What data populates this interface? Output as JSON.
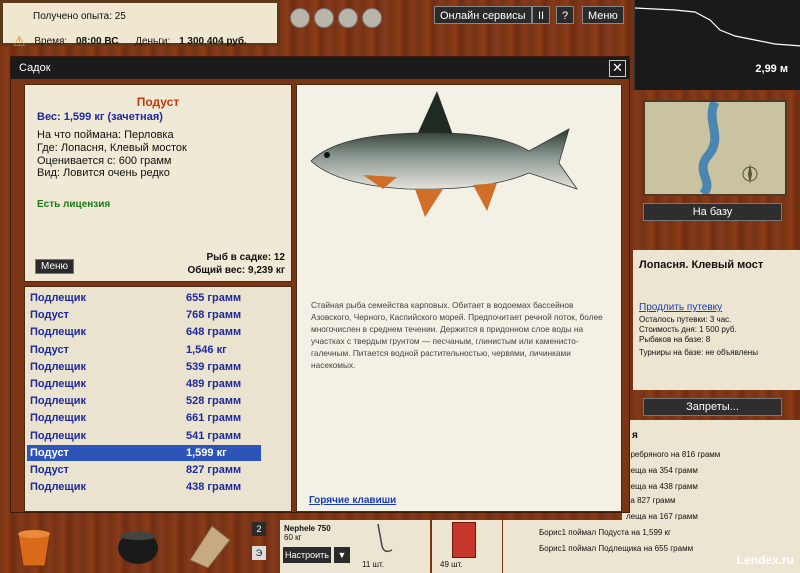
{
  "top_info": {
    "experience": "Получено опыта: 25",
    "time_label": "Время:",
    "time_value": "08:00 ВС",
    "money_label": "Деньги:",
    "money_value": "1 300 404 руб."
  },
  "top_buttons": {
    "online": "Онлайн сервисы",
    "pause": "II",
    "help": "?",
    "menu": "Меню"
  },
  "depth": {
    "value": "2,99 м"
  },
  "map": {
    "to_base": "На базу"
  },
  "location": {
    "title": "Лопасня. Клевый мост",
    "extend": "Продлить путевку",
    "left": "Осталось путевки: 3 час.",
    "price": "Стоимость дня: 1 500 руб.",
    "fishers": "Рыбаков на базе: 8",
    "tournaments": "Турниры на базе: не объявлены"
  },
  "bans": "Запреты...",
  "events_header": "я",
  "events": [
    "еребряного на 816 грамм",
    "леща на 354 грамм",
    "леща на 438 грамм",
    "на 827 грамм",
    "леща на 167 грамм"
  ],
  "bottom_log": [
    "Борис1 поймал Подуста на 1,599 кг",
    "Борис1 поймал Подлещика на 655 грамм"
  ],
  "dialog": {
    "title": "Садок",
    "close": "✕"
  },
  "fish_info": {
    "name": "Подуст",
    "weight": "Вес: 1,599 кг (зачетная)",
    "bait": "На что поймана: Перловка",
    "place": "Где: Лопасня, Клевый мосток",
    "valued": "Оценивается с: 600 грамм",
    "kind": "Вид: Ловится очень редко",
    "license": "Есть лицензия",
    "menu": "Меню",
    "count": "Рыб в садке: 12",
    "total": "Общий вес: 9,239 кг"
  },
  "catch_list": [
    {
      "name": "Подлещик",
      "weight": "655 грамм"
    },
    {
      "name": "Подуст",
      "weight": "768 грамм"
    },
    {
      "name": "Подлещик",
      "weight": "648 грамм"
    },
    {
      "name": "Подуст",
      "weight": "1,546 кг"
    },
    {
      "name": "Подлещик",
      "weight": "539 грамм"
    },
    {
      "name": "Подлещик",
      "weight": "489 грамм"
    },
    {
      "name": "Подлещик",
      "weight": "528 грамм"
    },
    {
      "name": "Подлещик",
      "weight": "661 грамм"
    },
    {
      "name": "Подлещик",
      "weight": "541 грамм"
    },
    {
      "name": "Подуст",
      "weight": "1,599 кг"
    },
    {
      "name": "Подуст",
      "weight": "827 грамм"
    },
    {
      "name": "Подлещик",
      "weight": "438 грамм"
    }
  ],
  "description": "Стайная рыба семейства карповых. Обитает в водоемах бассейнов Азовского, Черного, Каспийского морей. Предпочитает речной поток, более многочислен в среднем течении. Держится в придонном слое воды на участках с твердым грунтом — песчаным, глинистым или каменисто-галечным. Питается водной растительностью, червями, личинками насекомых.",
  "hotkeys": "Горячие клавиши",
  "tackle": {
    "name": "Nephele 750",
    "sub": "60 кг",
    "configure": "Настроить",
    "arrow": "▼",
    "slot2": "2",
    "slot_e": "Э"
  },
  "hook_count": "11 шт.",
  "bait_count": "49 шт.",
  "watermark": "Lendex.ru",
  "colors": {
    "wood": "#7a3414",
    "panel": "#efe9d6",
    "fish_blue": "#1e2a9c",
    "selected": "#2d54b8",
    "name_red": "#c23a0c",
    "license_green": "#1a7a1a"
  }
}
